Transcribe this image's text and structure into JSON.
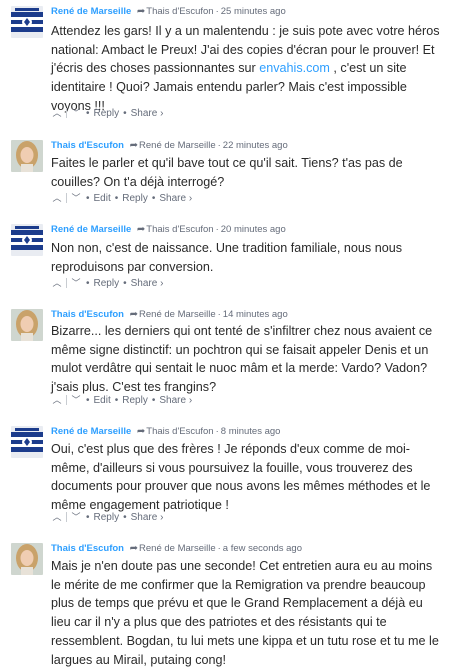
{
  "comments": [
    {
      "author": "René de Marseille",
      "reply_to": "Thais d'Escufon",
      "time": "25 minutes ago",
      "text_before_link": "Attendez les gars! Il y a un malentendu : je suis pote avec votre héros national: Ambact le Preux! J'ai des copies d'écran pour le prouver! Et j'écris des choses passionnantes sur ",
      "link": "envahis.com",
      "text_after_link": " , c'est un site identitaire ! Quoi? Jamais entendu parler? Mais c'est impossible voyons !!!",
      "actions": [
        "Reply",
        "Share ›"
      ]
    },
    {
      "author": "Thais d'Escufon",
      "reply_to": "René de Marseille",
      "time": "22 minutes ago",
      "text": "Faites le parler et qu'il bave tout ce qu'il sait. Tiens? t'as pas de couilles? On t'a déjà interrogé?",
      "actions": [
        "Edit",
        "Reply",
        "Share ›"
      ]
    },
    {
      "author": "René de Marseille",
      "reply_to": "Thais d'Escufon",
      "time": "20 minutes ago",
      "text": "Non non, c'est de naissance. Une tradition familiale, nous nous reproduisons par conversion.",
      "actions": [
        "Reply",
        "Share ›"
      ]
    },
    {
      "author": "Thais d'Escufon",
      "reply_to": "René de Marseille",
      "time": "14 minutes ago",
      "text": "Bizarre... les derniers qui ont tenté de s'infiltrer chez nous avaient ce même signe distinctif: un pochtron qui se faisait appeler Denis et un mulot verdâtre qui sentait le nuoc mâm et la merde: Vardo? Vadon? j'sais plus. C'est tes frangins?",
      "actions": [
        "Edit",
        "Reply",
        "Share ›"
      ]
    },
    {
      "author": "René de Marseille",
      "reply_to": "Thais d'Escufon",
      "time": "8 minutes ago",
      "text": "Oui, c'est plus que des frères ! Je réponds d'eux comme de moi-même, d'ailleurs si vous poursuivez la fouille, vous trouverez des documents pour prouver que nous avons les mêmes méthodes et le même engagement patriotique !",
      "actions": [
        "Reply",
        "Share ›"
      ]
    },
    {
      "author": "Thais d'Escufon",
      "reply_to": "René de Marseille",
      "time": "a few seconds ago",
      "text": "Mais je n'en doute pas une seconde! Cet entretien aura eu au moins le mérite de me confirmer que la Remigration va prendre beaucoup plus de temps que prévu et que le Grand Remplacement a déjà eu lieu car il n'y a plus que des patriotes et des résistants qui te ressemblent. Bogdan, tu lui mets une kippa et un tutu rose et tu me le largues au Mirail, putaing cong!"
    }
  ],
  "icons": {
    "reply_arrow": "share-arrow-icon",
    "upvote": "chevron-up-icon",
    "downvote": "chevron-down-icon"
  },
  "colors": {
    "author": "#2e9fff",
    "meta": "#656c7a",
    "text": "#2a2a2a",
    "link": "#2e9fff"
  }
}
